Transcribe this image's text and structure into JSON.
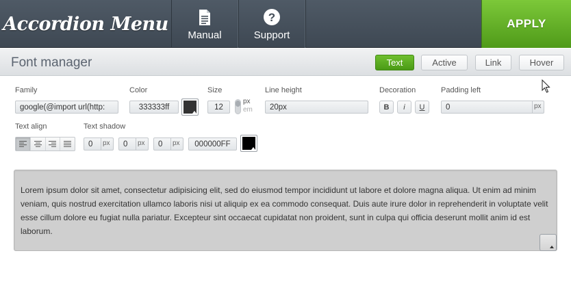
{
  "app": {
    "title": "Accordion Menu",
    "nav": {
      "manual": "Manual",
      "support": "Support",
      "support_glyph": "?"
    },
    "apply": "APPLY"
  },
  "header": {
    "title": "Font manager",
    "modes": [
      "Text",
      "Active",
      "Link",
      "Hover"
    ],
    "selected_mode": "Text"
  },
  "form": {
    "family": {
      "label": "Family",
      "value": "google(@import url(http:"
    },
    "color": {
      "label": "Color",
      "value": "333333ff",
      "swatch": "#333333"
    },
    "size": {
      "label": "Size",
      "value": "12",
      "units": [
        "px",
        "em"
      ],
      "selected_unit": "px"
    },
    "line_height": {
      "label": "Line height",
      "value": "20px"
    },
    "decoration": {
      "label": "Decoration",
      "buttons": [
        "B",
        "i",
        "U"
      ]
    },
    "padding_left": {
      "label": "Padding left",
      "value": "0",
      "unit": "px"
    },
    "text_align": {
      "label": "Text align",
      "options": [
        "left",
        "center",
        "right",
        "justify"
      ],
      "selected": "left"
    },
    "text_shadow": {
      "label": "Text shadow",
      "values": [
        "0",
        "0",
        "0"
      ],
      "unit": "px",
      "color": "000000FF",
      "swatch": "#000000"
    }
  },
  "preview": {
    "text": "Lorem ipsum dolor sit amet, consectetur adipisicing elit, sed do eiusmod tempor incididunt ut labore et dolore magna aliqua. Ut enim ad minim veniam, quis nostrud exercitation ullamco laboris nisi ut aliquip ex ea commodo consequat. Duis aute irure dolor in reprehenderit in voluptate velit esse cillum dolore eu fugiat nulla pariatur. Excepteur sint occaecat cupidatat non proident, sunt in culpa qui officia deserunt mollit anim id est laborum.",
    "background": "#cfcfcf"
  },
  "colors": {
    "topbar": "#434d58",
    "apply": "#5faf22",
    "accent_green": "#5aa81f"
  }
}
